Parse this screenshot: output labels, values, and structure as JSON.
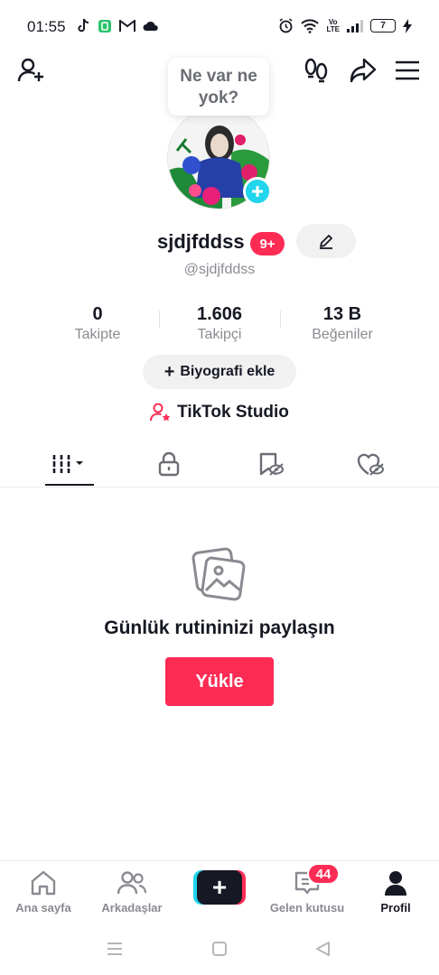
{
  "status_bar": {
    "time": "01:55",
    "battery": "7",
    "network": "VoLTE"
  },
  "top_bar": {
    "bubble_text": "Ne var ne yok?"
  },
  "profile": {
    "username": "sjdjfddss",
    "notification_badge": "9+",
    "handle": "@sjdjfddss"
  },
  "stats": [
    {
      "value": "0",
      "label": "Takipte"
    },
    {
      "value": "1.606",
      "label": "Takipçi"
    },
    {
      "value": "13 B",
      "label": "Beğeniler"
    }
  ],
  "bio_button": {
    "icon": "+",
    "label": "Biyografi ekle"
  },
  "studio": {
    "label": "TikTok Studio"
  },
  "empty_state": {
    "title": "Günlük rutininizi paylaşın",
    "upload_label": "Yükle"
  },
  "bottom_nav": {
    "items": [
      {
        "label": "Ana sayfa"
      },
      {
        "label": "Arkadaşlar"
      },
      {
        "label": "Gelen kutusu",
        "badge": "44"
      },
      {
        "label": "Profil"
      }
    ],
    "create_icon": "+"
  },
  "colors": {
    "accent": "#fe2c55",
    "cyan": "#20d5ec",
    "text": "#161823",
    "muted": "#8a8b91"
  }
}
